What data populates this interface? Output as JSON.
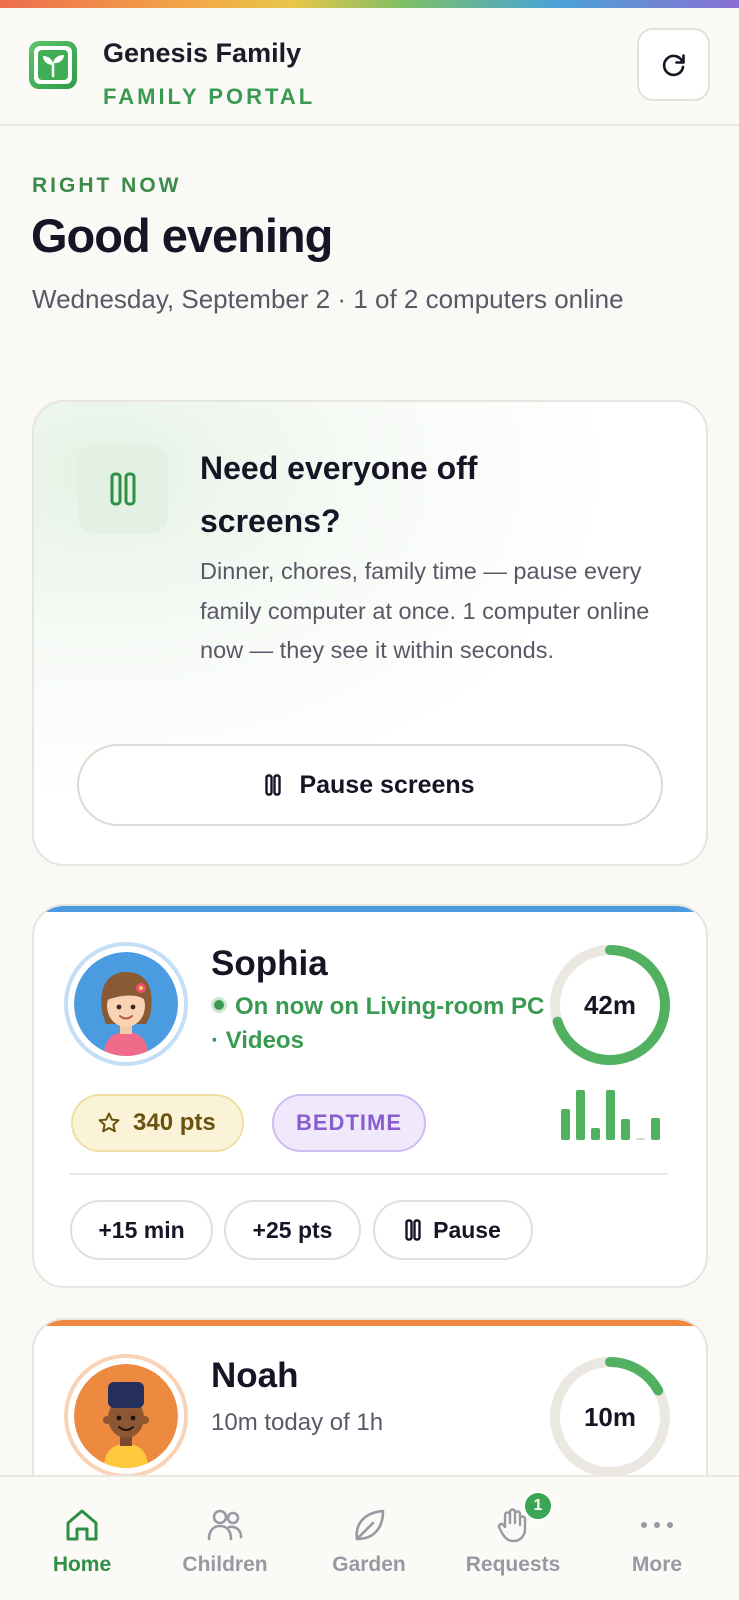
{
  "brand": {
    "name": "Genesis Family",
    "subtitle": "FAMILY PORTAL"
  },
  "hero": {
    "eyebrow": "RIGHT NOW",
    "greeting": "Good evening",
    "subline": "Wednesday, September 2 · 1 of 2 computers online"
  },
  "pause_card": {
    "title": "Need everyone off screens?",
    "description": "Dinner, chores, family time — pause every family computer at once. 1 computer online now — they see it within seconds.",
    "button_label": "Pause screens"
  },
  "children": [
    {
      "name": "Sophia",
      "status": "On now on Living-room PC · Videos",
      "time_label": "42m",
      "time_fraction": 0.7,
      "points": "340 pts",
      "mode_badge": "BEDTIME",
      "activity_levels": [
        0.62,
        1.0,
        0.25,
        1.0,
        0.42,
        0.05,
        0.44
      ],
      "actions": {
        "add_time": "+15 min",
        "add_points": "+25 pts",
        "pause": "Pause"
      },
      "accent_color": "#4a9be0"
    },
    {
      "name": "Noah",
      "status": "10m today of 1h",
      "time_label": "10m",
      "time_fraction": 0.17,
      "accent_color": "#ee8a3f"
    }
  ],
  "tabs": [
    {
      "label": "Home",
      "icon": "home-icon",
      "active": true
    },
    {
      "label": "Children",
      "icon": "children-icon",
      "active": false
    },
    {
      "label": "Garden",
      "icon": "leaf-icon",
      "active": false
    },
    {
      "label": "Requests",
      "icon": "hand-icon",
      "active": false,
      "badge": "1"
    },
    {
      "label": "More",
      "icon": "more-icon",
      "active": false
    }
  ],
  "colors": {
    "primary_green": "#3a9a52",
    "progress_green": "#52b161",
    "ring_track": "#ebe8e1"
  }
}
